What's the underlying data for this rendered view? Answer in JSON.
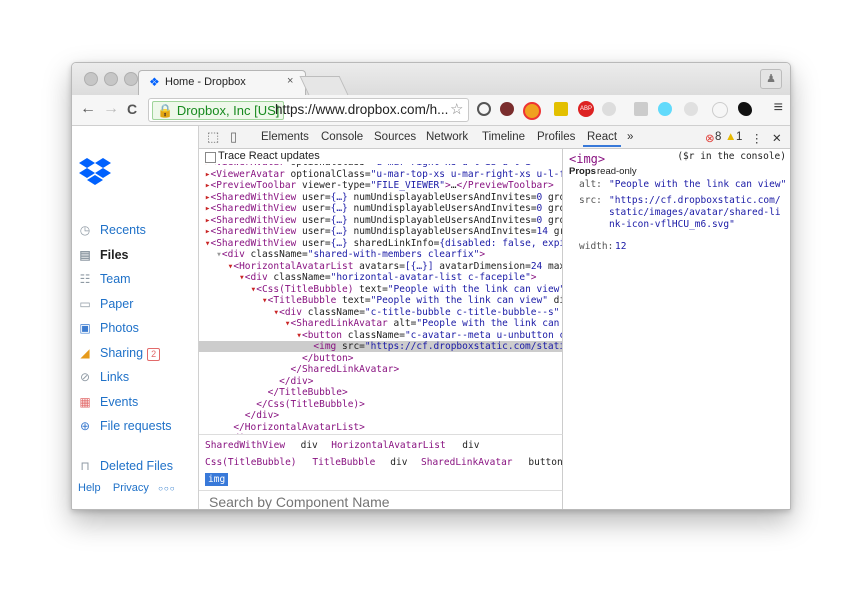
{
  "browser": {
    "tab_title": "Home - Dropbox",
    "tab_close": "×",
    "secure_label": "Dropbox, Inc [US]",
    "url": "https://www.dropbox.com/h...",
    "back_icon": "←",
    "forward_icon": "→",
    "reload_icon": "C",
    "star_icon": "☆",
    "menu_icon": "≡"
  },
  "sidebar": {
    "items": [
      {
        "label": "Recents",
        "icon": "clock-icon",
        "glyph": "◷"
      },
      {
        "label": "Files",
        "icon": "file-icon",
        "glyph": "▤"
      },
      {
        "label": "Team",
        "icon": "team-icon",
        "glyph": "☷"
      },
      {
        "label": "Paper",
        "icon": "paper-icon",
        "glyph": "▭"
      },
      {
        "label": "Photos",
        "icon": "photos-icon",
        "glyph": "▣"
      },
      {
        "label": "Sharing",
        "icon": "sharing-icon",
        "glyph": "◢",
        "badge": "2"
      },
      {
        "label": "Links",
        "icon": "link-icon",
        "glyph": "⊘"
      },
      {
        "label": "Events",
        "icon": "calendar-icon",
        "glyph": "▦"
      },
      {
        "label": "File requests",
        "icon": "file-request-icon",
        "glyph": "⊕"
      },
      {
        "label": "Deleted Files",
        "icon": "trash-icon",
        "glyph": "⊓"
      }
    ],
    "footer": {
      "help": "Help",
      "privacy": "Privacy",
      "more": "○○○"
    }
  },
  "devtools": {
    "tabs": [
      "Elements",
      "Console",
      "Sources",
      "Network",
      "Timeline",
      "Profiles",
      "React"
    ],
    "more_tabs": "»",
    "errors": "8",
    "warnings": "1",
    "kebab": "⋮",
    "close": "✕",
    "trace_label": "Trace React updates",
    "tree_lines": [
      {
        "arrow": "▸",
        "text": "<ViewerAvatar optionalClass=\"u-mar-right-xs u-l-ib u-l-i"
      },
      {
        "arrow": "▸",
        "text": "<ViewerAvatar optionalClass=\"u-mar-top-xs u-mar-right-xs u-l-fl"
      },
      {
        "arrow": "▸",
        "text": "<PreviewToolbar viewer-type=\"FILE_VIEWER\">…</PreviewToolbar>"
      },
      {
        "arrow": "▸",
        "text": "<SharedWithView user={…} numUndisplayableUsersAndInvites=0 gro"
      },
      {
        "arrow": "▸",
        "text": "<SharedWithView user={…} numUndisplayableUsersAndInvites=0 gro"
      },
      {
        "arrow": "▸",
        "text": "<SharedWithView user={…} numUndisplayableUsersAndInvites=0 gro"
      },
      {
        "arrow": "▸",
        "text": "<SharedWithView user={…} numUndisplayableUsersAndInvites=14 gr"
      },
      {
        "arrow": "▾",
        "text": "<SharedWithView user={…} sharedLinkInfo={disabled: false, expi"
      },
      {
        "arrow": "▾",
        "text": "  <div className=\"shared-with-members clearfix\">"
      },
      {
        "arrow": "▾",
        "text": "    <HorizontalAvatarList avatars=[{…}] avatarDimension=24 maxVi"
      },
      {
        "arrow": "▾",
        "text": "      <div className=\"horizontal-avatar-list c-facepile\">"
      },
      {
        "arrow": "▾",
        "text": "        <Css(TitleBubble) text=\"People with the link can view\" di"
      },
      {
        "arrow": "▾",
        "text": "          <TitleBubble text=\"People with the link can view\" direct"
      },
      {
        "arrow": "▾",
        "text": "            <div className=\"c-title-bubble c-title-bubble--s\" data"
      },
      {
        "arrow": "▾",
        "text": "              <SharedLinkAvatar alt=\"People with the link can view"
      },
      {
        "arrow": "▾",
        "text": "                <button className=\"c-avatar--meta u-unbutton c-avat"
      },
      {
        "arrow": "",
        "text": "                  <img src=\"https://cf.dropboxstatic.com/static/ima"
      },
      {
        "arrow": "",
        "text": "                </button>"
      },
      {
        "arrow": "",
        "text": "              </SharedLinkAvatar>"
      },
      {
        "arrow": "",
        "text": "            </div>"
      },
      {
        "arrow": "",
        "text": "          </TitleBubble>"
      },
      {
        "arrow": "",
        "text": "        </Css(TitleBubble)>"
      },
      {
        "arrow": "",
        "text": "      </div>"
      },
      {
        "arrow": "",
        "text": "    </HorizontalAvatarList>"
      },
      {
        "arrow": "",
        "text": "  </div>"
      },
      {
        "arrow": "",
        "text": "</SharedWithView>"
      }
    ],
    "breadcrumbs": {
      "row1": [
        {
          "text": "SharedWithView",
          "kind": "tag"
        },
        {
          "text": "div",
          "kind": "plain"
        },
        {
          "text": "HorizontalAvatarList",
          "kind": "tag"
        },
        {
          "text": "div",
          "kind": "plain"
        }
      ],
      "row2": [
        {
          "text": "Css(TitleBubble)",
          "kind": "tag"
        },
        {
          "text": "TitleBubble",
          "kind": "tag"
        },
        {
          "text": "div",
          "kind": "plain"
        },
        {
          "text": "SharedLinkAvatar",
          "kind": "tag"
        },
        {
          "text": "button",
          "kind": "plain"
        }
      ],
      "current": "img"
    },
    "search_placeholder": "Search by Component Name",
    "pane": {
      "tag": "<img>",
      "hint": "($r in the console)",
      "props_heading": "Props",
      "props_note": "read-only",
      "props": [
        {
          "key": "alt:",
          "value": "\"People with the link can view\""
        },
        {
          "key": "src:",
          "value": "\"https://cf.dropboxstatic.com/static/images/avatar/shared-link-icon-vflHCU_m6.svg\""
        },
        {
          "key": "width:",
          "value": "12"
        }
      ]
    }
  },
  "colors": {
    "dropbox_blue": "#0061fe",
    "link_blue": "#1f71c8",
    "tag_purple": "#881280",
    "attr_brown": "#994500",
    "value_blue": "#1a1aa6",
    "error_red": "#e0403a",
    "warn_yellow": "#e6b800",
    "react_selected": "#3879d9"
  }
}
